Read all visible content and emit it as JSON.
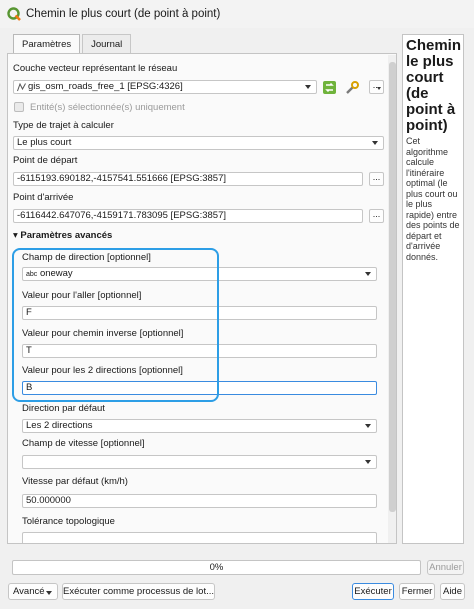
{
  "window": {
    "title": "Chemin le plus court (de point à point)"
  },
  "tabs": [
    {
      "label": "Paramètres"
    },
    {
      "label": "Journal"
    }
  ],
  "form": {
    "network_layer": {
      "label": "Couche vecteur représentant le réseau",
      "value": "gis_osm_roads_free_1 [EPSG:4326]"
    },
    "selected_only": {
      "label": "Entité(s) sélectionnée(s) uniquement",
      "checked": false
    },
    "path_type": {
      "label": "Type de trajet à calculer",
      "value": "Le plus court"
    },
    "start_point": {
      "label": "Point de départ",
      "value": "-6115193.690182,-4157541.551666 [EPSG:3857]"
    },
    "end_point": {
      "label": "Point d'arrivée",
      "value": "-6116442.647076,-4159171.783095 [EPSG:3857]"
    },
    "advanced": {
      "label": "Paramètres avancés",
      "arrow": "▾"
    },
    "direction_field": {
      "label": "Champ de direction [optionnel]",
      "type_badge": "abc",
      "value": "oneway"
    },
    "forward_value": {
      "label": "Valeur pour l'aller [optionnel]",
      "value": "F"
    },
    "backward_value": {
      "label": "Valeur pour chemin inverse [optionnel]",
      "value": "T"
    },
    "both_value": {
      "label": "Valeur pour les 2 directions [optionnel]",
      "value": "B"
    },
    "default_direction": {
      "label": "Direction par défaut",
      "value": "Les 2 directions"
    },
    "speed_field": {
      "label": "Champ de vitesse [optionnel]",
      "value": ""
    },
    "default_speed": {
      "label": "Vitesse par défaut (km/h)",
      "value": "50.000000"
    },
    "tolerance": {
      "label": "Tolérance topologique"
    },
    "browse_label": "..."
  },
  "help": {
    "title": "Chemin le plus court (de point à point)",
    "description": "Cet algorithme calcule l'itinéraire optimal (le plus court ou le plus rapide) entre des points de départ et d'arrivée donnés."
  },
  "progress": {
    "value": "0%",
    "fraction": 0.0
  },
  "buttons": {
    "advanced": "Avancé",
    "batch": "Exécuter comme processus de lot...",
    "cancel": "Annuler",
    "run": "Exécuter",
    "close": "Fermer",
    "help": "Aide"
  },
  "colors": {
    "highlight": "#2d9ee6",
    "qgis_green": "#589632",
    "qgis_yellow": "#ee7913"
  }
}
